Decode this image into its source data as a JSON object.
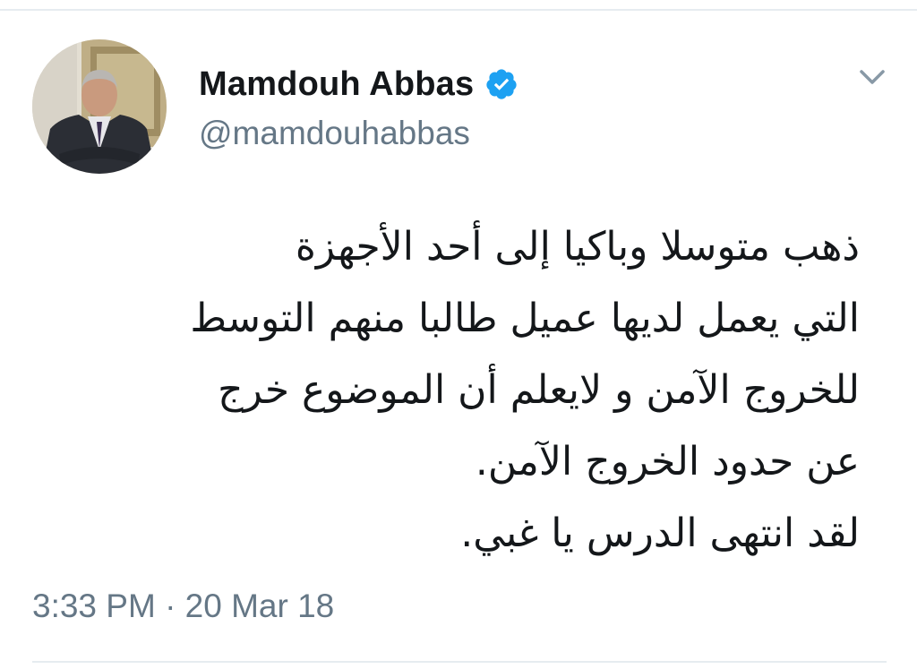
{
  "tweet": {
    "author": {
      "display_name": "Mamdouh Abbas",
      "handle": "@mamdouhabbas",
      "verified": true,
      "verified_icon": "verified-badge-icon"
    },
    "menu_icon": "chevron-down-icon",
    "text_lines": [
      "ذهب متوسلا وباكيا إلى أحد الأجهزة",
      "التي يعمل لديها عميل طالبا منهم التوسط",
      "للخروج الآمن و لايعلم أن الموضوع خرج",
      "عن حدود الخروج الآمن.",
      "لقد انتهى الدرس يا غبي."
    ],
    "timestamp": "3:33 PM · 20 Mar 18"
  },
  "colors": {
    "text_primary": "#14171a",
    "text_secondary": "#657786",
    "verified_blue": "#1da1f2",
    "chevron": "#8899a6",
    "divider": "#e6ecf0"
  }
}
